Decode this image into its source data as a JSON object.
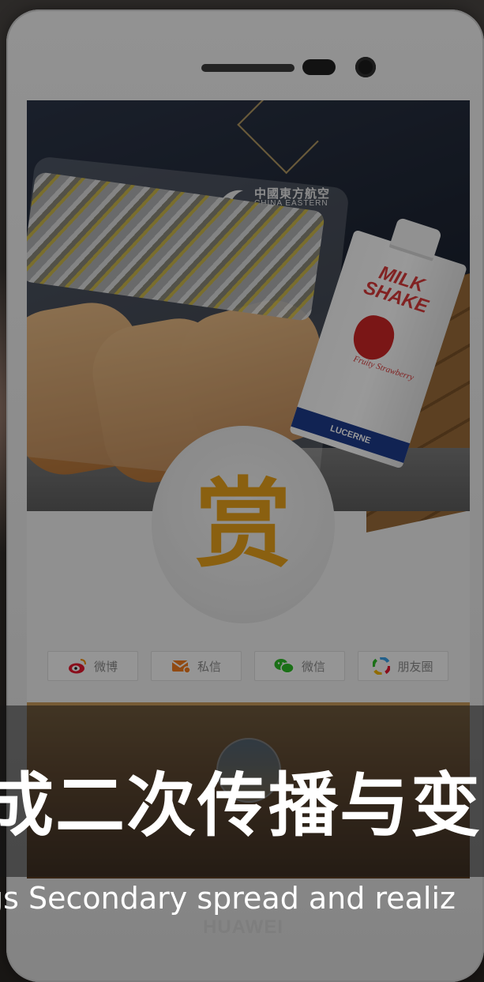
{
  "phone": {
    "brand": "HUAWEI"
  },
  "photo": {
    "airline_zh": "中國東方航空",
    "airline_en": "CHINA EASTERN",
    "carton_title": "MILK SHAKE",
    "carton_sub": "Fruity Strawberry",
    "carton_brand": "LUCERNE"
  },
  "reward": {
    "char": "赏"
  },
  "share": [
    {
      "label": "微博",
      "icon": "weibo-icon",
      "color": "#e6162d"
    },
    {
      "label": "私信",
      "icon": "envelope-icon",
      "color": "#f27c1e"
    },
    {
      "label": "微信",
      "icon": "wechat-icon",
      "color": "#2dbb27"
    },
    {
      "label": "朋友圈",
      "icon": "moments-icon",
      "color": "#3aa0e8"
    }
  ],
  "overlay": {
    "headline": "成二次传播与变",
    "subline": "gs Secondary spread and realiz"
  },
  "colors": {
    "reward_accent": "#e6a11c",
    "band": "#161616"
  }
}
